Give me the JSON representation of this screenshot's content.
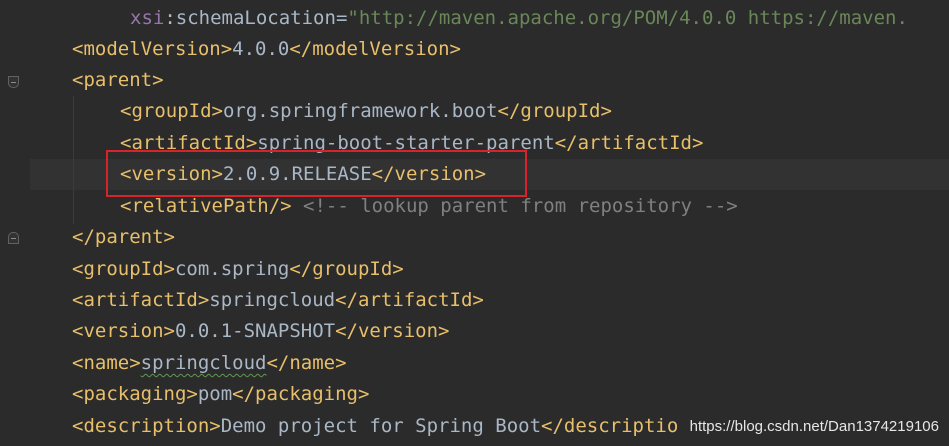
{
  "editor": {
    "lines": [
      {
        "parts": [
          {
            "cls": "attr",
            "t": "xsi"
          },
          {
            "cls": "ns",
            "t": ":"
          },
          {
            "cls": "text",
            "t": "schemaLocation"
          },
          {
            "cls": "text",
            "t": "="
          },
          {
            "cls": "str",
            "t": "\"http://maven.apache.org/POM/4.0.0 https://maven."
          }
        ]
      },
      {
        "parts": [
          {
            "cls": "tag",
            "t": "<modelVersion>"
          },
          {
            "cls": "text",
            "t": "4.0.0"
          },
          {
            "cls": "tag",
            "t": "</modelVersion>"
          }
        ]
      },
      {
        "parts": [
          {
            "cls": "tag",
            "t": "<parent>"
          }
        ]
      },
      {
        "parts": [
          {
            "cls": "tag",
            "t": "<groupId>"
          },
          {
            "cls": "text",
            "t": "org.springframework.boot"
          },
          {
            "cls": "tag",
            "t": "</groupId>"
          }
        ]
      },
      {
        "parts": [
          {
            "cls": "tag",
            "t": "<artifactId>"
          },
          {
            "cls": "text",
            "t": "spring-boot-starter-parent"
          },
          {
            "cls": "tag",
            "t": "</artifactId>"
          }
        ]
      },
      {
        "parts": [
          {
            "cls": "tag",
            "t": "<version>"
          },
          {
            "cls": "text",
            "t": "2.0.9.RELEASE"
          },
          {
            "cls": "tag",
            "t": "</version>"
          }
        ]
      },
      {
        "parts": [
          {
            "cls": "tag",
            "t": "<relativePath/>"
          },
          {
            "cls": "comment",
            "t": " <!-- lookup parent from repository -->"
          }
        ]
      },
      {
        "parts": [
          {
            "cls": "tag",
            "t": "</parent>"
          }
        ]
      },
      {
        "parts": [
          {
            "cls": "tag",
            "t": "<groupId>"
          },
          {
            "cls": "text",
            "t": "com.spring"
          },
          {
            "cls": "tag",
            "t": "</groupId>"
          }
        ]
      },
      {
        "parts": [
          {
            "cls": "tag",
            "t": "<artifactId>"
          },
          {
            "cls": "text",
            "t": "springcloud"
          },
          {
            "cls": "tag",
            "t": "</artifactId>"
          }
        ]
      },
      {
        "parts": [
          {
            "cls": "tag",
            "t": "<version>"
          },
          {
            "cls": "text",
            "t": "0.0.1-SNAPSHOT"
          },
          {
            "cls": "tag",
            "t": "</version>"
          }
        ]
      },
      {
        "parts": [
          {
            "cls": "tag",
            "t": "<name>"
          },
          {
            "cls": "text squiggle",
            "t": "springcloud"
          },
          {
            "cls": "tag",
            "t": "</name>"
          }
        ]
      },
      {
        "parts": [
          {
            "cls": "tag",
            "t": "<packaging>"
          },
          {
            "cls": "text",
            "t": "pom"
          },
          {
            "cls": "tag",
            "t": "</packaging>"
          }
        ]
      },
      {
        "parts": [
          {
            "cls": "tag",
            "t": "<description>"
          },
          {
            "cls": "text",
            "t": "Demo project for Spring Boot"
          },
          {
            "cls": "tag",
            "t": "</descriptio"
          }
        ]
      }
    ]
  },
  "watermark": "https://blog.csdn.net/Dan1374219106",
  "colors": {
    "background": "#2b2b2b",
    "tag": "#e8bf6a",
    "text": "#a9b7c6",
    "attribute": "#9876aa",
    "string": "#6a8759",
    "comment": "#808080",
    "highlight_box": "#d9232a"
  }
}
